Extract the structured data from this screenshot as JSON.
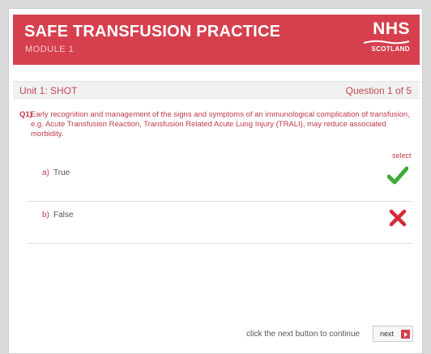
{
  "banner": {
    "title": "SAFE TRANSFUSION PRACTICE",
    "subtitle": "MODULE 1",
    "logo_main": "NHS",
    "logo_sub": "SCOTLAND"
  },
  "unit": {
    "label": "Unit 1: SHOT",
    "question_counter": "Question 1 of 5"
  },
  "question": {
    "number": "Q1)",
    "text": "Early recognition and management of the signs and symptoms of an immunological complication of transfusion, e.g. Acute Transfusion Reaction, Transfusion Related Acute Lung Injury (TRALI), may reduce associated morbidity."
  },
  "select_header": "select",
  "options": [
    {
      "letter": "a)",
      "text": "True",
      "icon": "check-icon",
      "color": "#3faa3a"
    },
    {
      "letter": "b)",
      "text": "False",
      "icon": "cross-icon",
      "color": "#d6283a"
    }
  ],
  "footer": {
    "hint": "click the next button to continue",
    "next_label": "next"
  },
  "colors": {
    "brand_red": "#d6404e",
    "text_red": "#c0394a"
  }
}
